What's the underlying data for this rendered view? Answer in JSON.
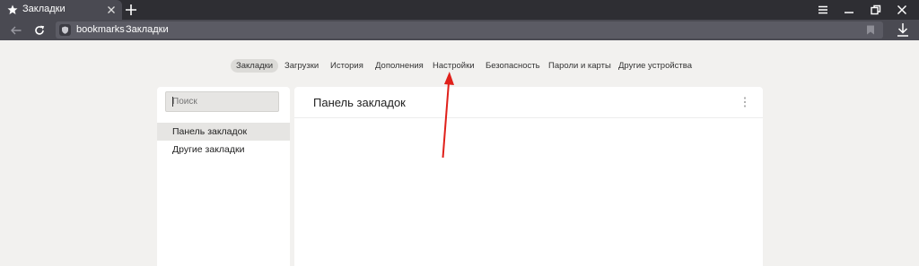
{
  "browser": {
    "tab": {
      "title": "Закладки"
    },
    "address": {
      "host": "bookmarks",
      "title": "Закладки"
    }
  },
  "pages_nav": [
    {
      "label": "Закладки",
      "active": true
    },
    {
      "label": "Загрузки",
      "active": false
    },
    {
      "label": "История",
      "active": false
    },
    {
      "label": "Дополнения",
      "active": false
    },
    {
      "label": "Настройки",
      "active": false
    },
    {
      "label": "Безопасность",
      "active": false
    },
    {
      "label": "Пароли и карты",
      "active": false
    },
    {
      "label": "Другие устройства",
      "active": false
    }
  ],
  "sidebar": {
    "search_placeholder": "Поиск",
    "folders": [
      {
        "label": "Панель закладок",
        "selected": true
      },
      {
        "label": "Другие закладки",
        "selected": false
      }
    ]
  },
  "main": {
    "title": "Панель закладок"
  },
  "colors": {
    "tab_bar": "#2e2e33",
    "toolbar": "#4a4a52",
    "page_background": "#f2f1ef",
    "annotation_arrow": "#e0201a"
  },
  "icons": {
    "tab": "star-icon",
    "close": "close-icon",
    "new_tab": "plus-icon",
    "menu": "hamburger-menu-icon",
    "minimize": "minimize-icon",
    "restore": "restore-icon",
    "window_close": "window-close-icon",
    "back": "back-arrow-icon",
    "reload": "reload-icon",
    "protect": "shield-icon",
    "bookmark": "bookmark-flag-icon",
    "download": "download-icon",
    "more": "more-vertical-icon"
  }
}
